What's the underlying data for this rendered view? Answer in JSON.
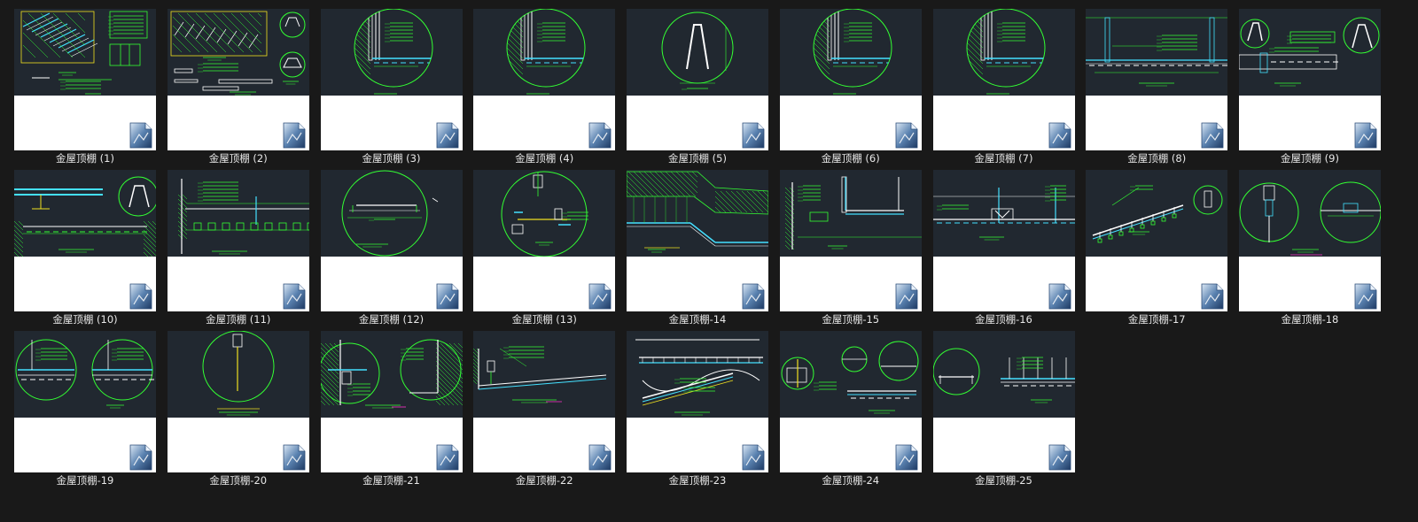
{
  "files": [
    {
      "name": "金屋顶棚 (1)",
      "variant": 0
    },
    {
      "name": "金屋顶棚 (2)",
      "variant": 1
    },
    {
      "name": "金屋顶棚 (3)",
      "variant": 2
    },
    {
      "name": "金屋顶棚 (4)",
      "variant": 2
    },
    {
      "name": "金屋顶棚 (5)",
      "variant": 3
    },
    {
      "name": "金屋顶棚 (6)",
      "variant": 2
    },
    {
      "name": "金屋顶棚 (7)",
      "variant": 2
    },
    {
      "name": "金屋顶棚 (8)",
      "variant": 4
    },
    {
      "name": "金屋顶棚 (9)",
      "variant": 5
    },
    {
      "name": "金屋顶棚 (10)",
      "variant": 6
    },
    {
      "name": "金屋顶棚 (11)",
      "variant": 7
    },
    {
      "name": "金屋顶棚 (12)",
      "variant": 8
    },
    {
      "name": "金屋顶棚 (13)",
      "variant": 9
    },
    {
      "name": "金屋顶棚-14",
      "variant": 10
    },
    {
      "name": "金屋顶棚-15",
      "variant": 11
    },
    {
      "name": "金屋顶棚-16",
      "variant": 12
    },
    {
      "name": "金屋顶棚-17",
      "variant": 13
    },
    {
      "name": "金屋顶棚-18",
      "variant": 14
    },
    {
      "name": "金屋顶棚-19",
      "variant": 15
    },
    {
      "name": "金屋顶棚-20",
      "variant": 16
    },
    {
      "name": "金屋顶棚-21",
      "variant": 17
    },
    {
      "name": "金屋顶棚-22",
      "variant": 18
    },
    {
      "name": "金屋顶棚-23",
      "variant": 19
    },
    {
      "name": "金屋顶棚-24",
      "variant": 20
    },
    {
      "name": "金屋顶棚-25",
      "variant": 21
    }
  ],
  "colors": {
    "background": "#191919",
    "preview_bg": "#212830",
    "cad_green": "#33ff33",
    "cad_white": "#ffffff",
    "cad_cyan": "#44e0ff",
    "cad_yellow": "#f0e020",
    "cad_magenta": "#ff33cc",
    "label_text": "#e8e8e8"
  },
  "file_icon": "cad-document-icon"
}
